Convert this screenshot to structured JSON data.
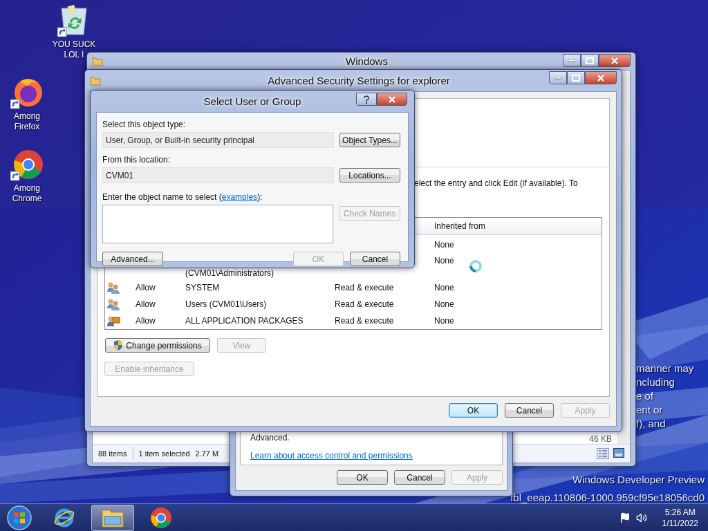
{
  "desktop": {
    "icons": [
      {
        "kind": "recycle",
        "label": "YOU SUCK LOL I"
      },
      {
        "kind": "firefox",
        "label": "Among Firefox"
      },
      {
        "kind": "chrome",
        "label": "Among Chrome"
      }
    ],
    "background_text": [
      "manner may",
      "ncluding",
      "e of",
      "ent or",
      "f), and"
    ],
    "edition": "Windows Developer Preview",
    "build": "fbl_eeap.110806-1000.959cf95e18056cd0"
  },
  "explorer_window": {
    "title": "Windows",
    "file_size": "46 KB",
    "status_bar": {
      "item_count": "88 items",
      "selection": "1 item selected",
      "selection_size": "2.77 M"
    }
  },
  "properties_dialog": {
    "text": "Advanced.",
    "link": "Learn about access control and permissions",
    "buttons": [
      {
        "label": "OK",
        "disabled": false,
        "default": false
      },
      {
        "label": "Cancel",
        "disabled": false,
        "default": false
      },
      {
        "label": "Apply",
        "disabled": true,
        "default": false
      }
    ]
  },
  "advanced_security_window": {
    "title": "Advanced Security Settings for explorer",
    "instructions": "elect the entry and click Edit (if available). To",
    "table": {
      "columns": [
        "Inherited from"
      ],
      "rows": [
        {
          "kind": "blank",
          "inherited_from": "None"
        },
        {
          "kind": "wrapped",
          "principal": "(CVM01\\Administrators)",
          "inherited_from": "None"
        },
        {
          "kind": "group",
          "type": "Allow",
          "principal": "SYSTEM",
          "access": "Read & execute",
          "inherited_from": "None"
        },
        {
          "kind": "group",
          "type": "Allow",
          "principal": "Users (CVM01\\Users)",
          "access": "Read & execute",
          "inherited_from": "None"
        },
        {
          "kind": "package",
          "type": "Allow",
          "principal": "ALL APPLICATION PACKAGES",
          "access": "Read & execute",
          "inherited_from": "None"
        }
      ]
    },
    "actions": [
      {
        "kind": "shield",
        "label": "Change permissions",
        "disabled": false
      },
      {
        "kind": "plain",
        "label": "View",
        "disabled": true
      }
    ],
    "inheritance_button": {
      "label": "Enable inheritance",
      "disabled": true
    },
    "buttons": [
      {
        "label": "OK",
        "disabled": false,
        "default": true
      },
      {
        "label": "Cancel",
        "disabled": false,
        "default": false
      },
      {
        "label": "Apply",
        "disabled": true,
        "default": false
      }
    ]
  },
  "select_dialog": {
    "title": "Select User or Group",
    "object_type_label": "Select this object type:",
    "object_type": "User, Group, or Built-in security principal",
    "object_types_button": "Object Types...",
    "location_label": "From this location:",
    "location": "CVM01",
    "locations_button": "Locations...",
    "name_prompt": "Enter the object name to select (",
    "examples_link": "examples",
    "name_prompt_end": "):",
    "check_names": {
      "label": "Check Names",
      "disabled": true
    },
    "buttons": [
      {
        "label": "Advanced...",
        "disabled": false
      },
      {
        "label": "OK",
        "disabled": true
      },
      {
        "label": "Cancel",
        "disabled": false
      }
    ]
  },
  "taskbar": {
    "apps": [
      {
        "kind": "ie",
        "selected": false
      },
      {
        "kind": "explorer",
        "selected": true
      },
      {
        "kind": "chrome",
        "selected": false
      }
    ],
    "time": "5:26 AM",
    "date": "1/11/2022"
  }
}
